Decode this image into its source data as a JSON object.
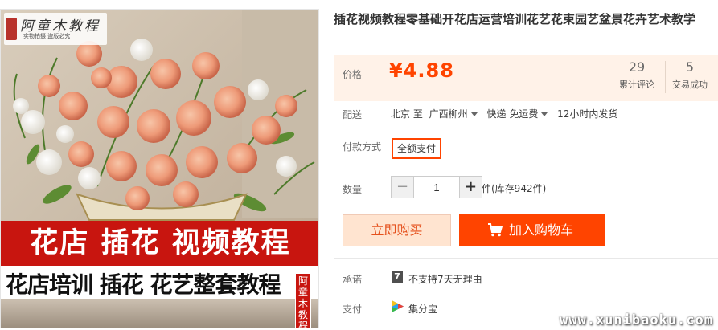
{
  "product": {
    "title": "插花视频教程零基础开花店运营培训花艺花束园艺盆景花卉艺术教学",
    "image": {
      "brand_name": "阿童木教程",
      "brand_sub": "实物拍摄 盗版必究",
      "banner_line1": "花店 插花 视频教程",
      "banner_line2": "花店培训 插花 花艺整套教程",
      "stamp": "阿童木教程"
    }
  },
  "price": {
    "label": "价格",
    "value": "¥4.88",
    "reviews_count": "29",
    "reviews_label": "累计评论",
    "trades_count": "5",
    "trades_label": "交易成功"
  },
  "shipping": {
    "label": "配送",
    "from": "北京 至",
    "to": "广西柳州",
    "method": "快递 免运费",
    "dispatch": "12小时内发货"
  },
  "payment_method": {
    "label": "付款方式",
    "option": "全额支付"
  },
  "quantity": {
    "label": "数量",
    "minus": "−",
    "value": "1",
    "plus": "+",
    "stock": "件(库存942件)"
  },
  "actions": {
    "buy_now": "立即购买",
    "add_cart": "加入购物车"
  },
  "promise": {
    "label": "承诺",
    "icon_text": "7",
    "text": "不支持7天无理由"
  },
  "pay": {
    "label": "支付",
    "text": "集分宝"
  },
  "watermark": "www.xunibaoku.com",
  "colors": {
    "accent": "#ff4400",
    "price_bg": "#fff2e8",
    "banner_red": "#c8150f"
  }
}
